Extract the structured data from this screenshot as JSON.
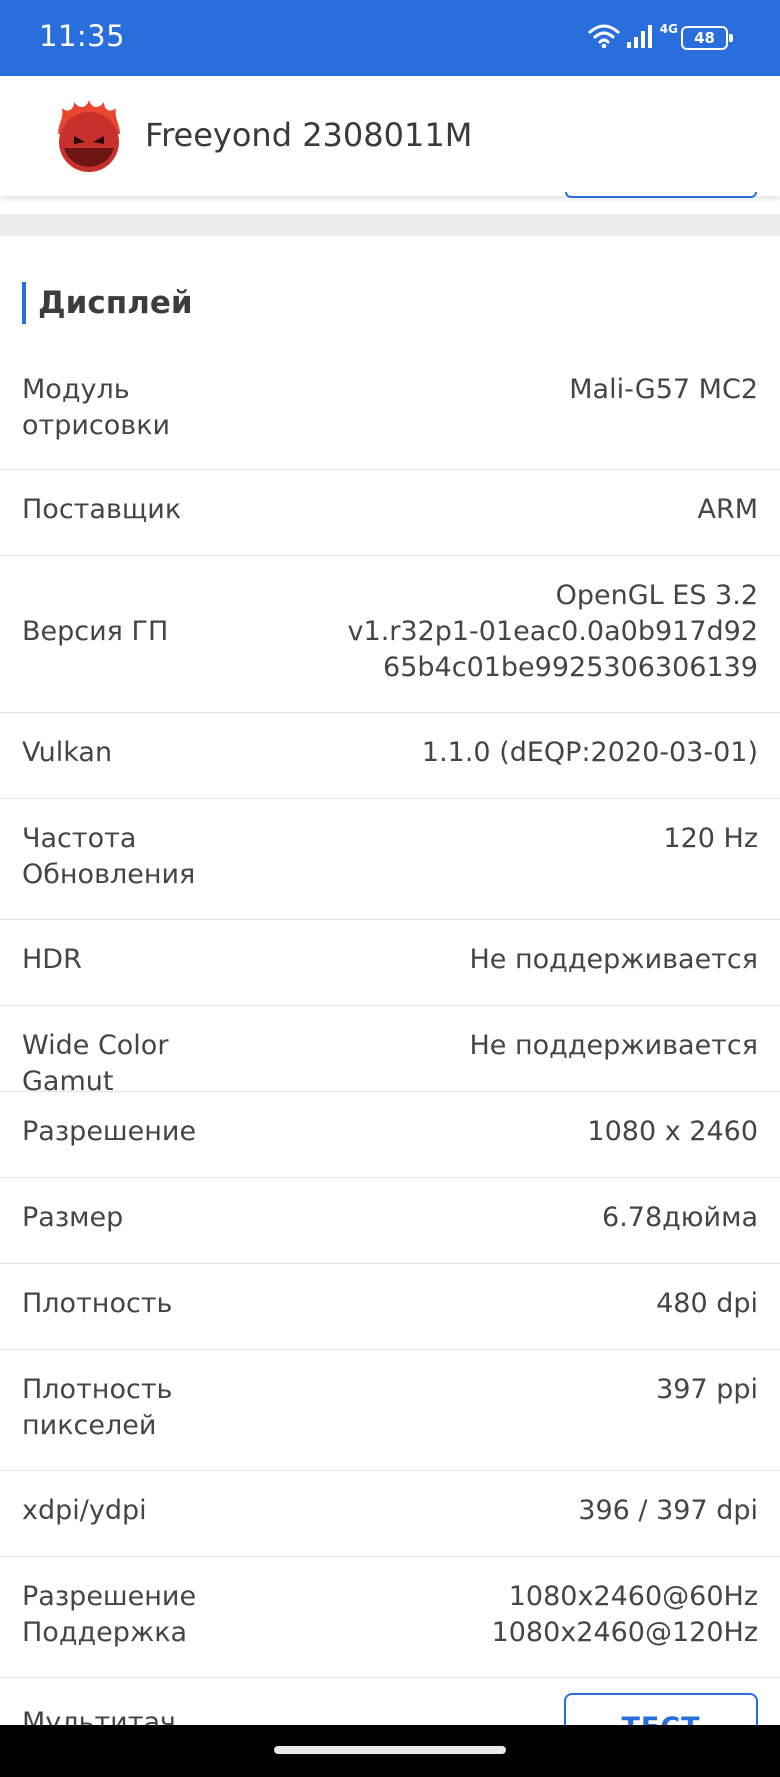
{
  "status_bar": {
    "time": "11:35",
    "network_label": "4G",
    "battery_level": "48"
  },
  "header": {
    "device_name": "Freeyond 2308011M"
  },
  "section": {
    "title": "Дисплей"
  },
  "rows": [
    {
      "label": "Модуль\nотрисовки",
      "value": "Mali-G57 MC2"
    },
    {
      "label": "Поставщик",
      "value": "ARM"
    },
    {
      "label": "Версия ГП",
      "value": "OpenGL ES 3.2\nv1.r32p1-01eac0.0a0b917d92\n65b4c01be9925306306139"
    },
    {
      "label": "Vulkan",
      "value": "1.1.0 (dEQP:2020-03-01)"
    },
    {
      "label": "Частота\nОбновления",
      "value": "120 Hz"
    },
    {
      "label": "HDR",
      "value": "Не поддерживается"
    },
    {
      "label": "Wide Color Gamut",
      "value": "Не поддерживается"
    },
    {
      "label": "Разрешение",
      "value": "1080 x 2460"
    },
    {
      "label": "Размер",
      "value": "6.78дюйма"
    },
    {
      "label": "Плотность",
      "value": "480 dpi"
    },
    {
      "label": "Плотность\nпикселей",
      "value": "397 ppi"
    },
    {
      "label": "xdpi/ydpi",
      "value": "396 / 397 dpi"
    },
    {
      "label": "Разрешение\nПоддержка",
      "value": "1080x2460@60Hz\n1080x2460@120Hz"
    }
  ],
  "partial_row": {
    "label": "Мультитач",
    "button_label": "ТЕСТ"
  },
  "colors": {
    "accent": "#2a6ede",
    "status_bar": "#2a6ede",
    "divider": "#e3e3e3",
    "band": "#ebebeb"
  },
  "icons": {
    "wifi": "wifi-icon",
    "signal": "signal-icon",
    "battery": "battery-icon",
    "logo": "antutu-flame-logo"
  }
}
